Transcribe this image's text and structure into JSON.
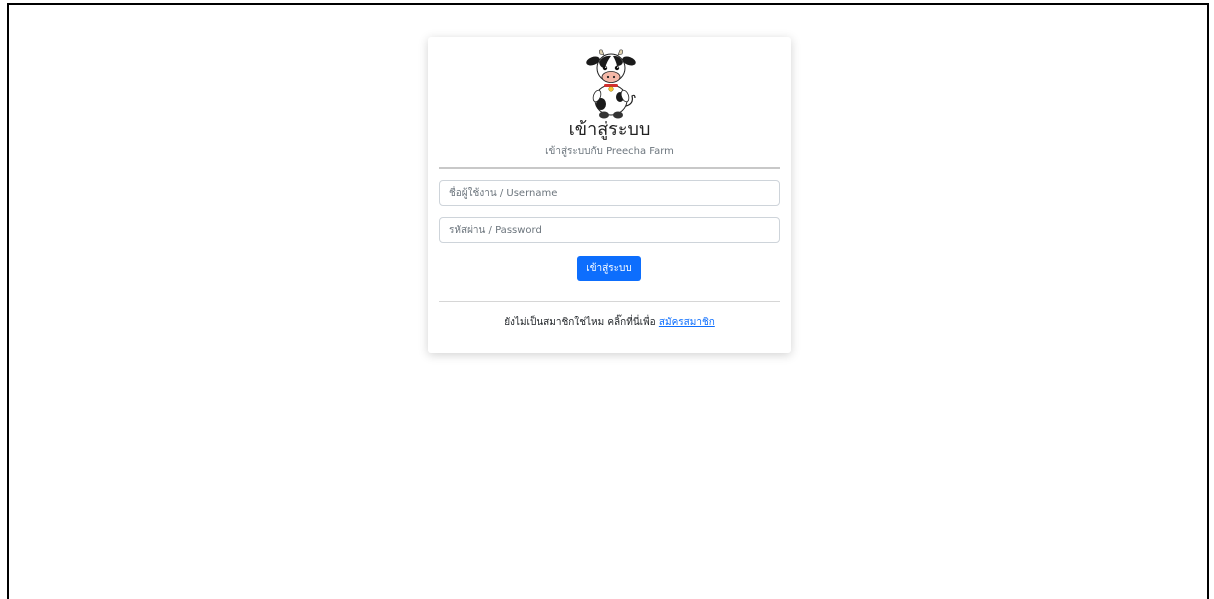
{
  "login": {
    "title": "เข้าสู่ระบบ",
    "subtitle": "เข้าสู่ระบบกับ Preecha Farm",
    "username_placeholder": "ชื่อผู้ใช้งาน / Username",
    "password_placeholder": "รหัสผ่าน / Password",
    "submit_label": "เข้าสู่ระบบ",
    "register_prompt": "ยังไม่เป็นสมาชิกใช่ไหม คลิ๊กที่นี่เพื่อ ",
    "register_link": "สมัครสมาชิก",
    "logo_icon": "cow-mascot-icon"
  },
  "colors": {
    "primary": "#0d6efd",
    "muted": "#6c757d"
  }
}
